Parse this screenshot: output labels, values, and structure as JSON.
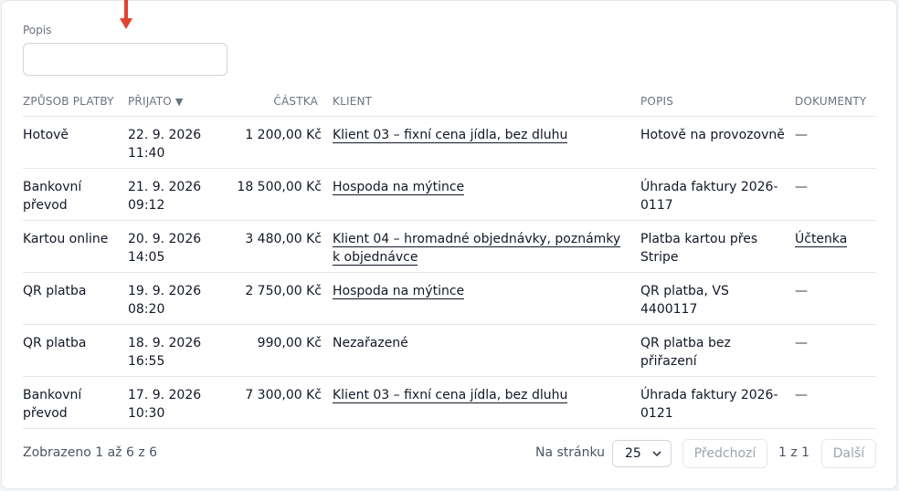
{
  "filter": {
    "label": "Popis",
    "value": "",
    "placeholder": ""
  },
  "columns": {
    "method": "ZPŮSOB PLATBY",
    "received": "PŘIJATO",
    "received_sort": "▼",
    "amount": "ČÁSTKA",
    "client": "KLIENT",
    "description": "POPIS",
    "documents": "DOKUMENTY"
  },
  "rows": [
    {
      "method": "Hotově",
      "date": "22. 9. 2026",
      "time": "11:40",
      "amount": "1 200,00 Kč",
      "client": "Klient 03 – fixní cena jídla, bez dluhu",
      "client_link": true,
      "description": "Hotově na provozovně",
      "document": "—",
      "document_link": false
    },
    {
      "method": "Bankovní převod",
      "date": "21. 9. 2026",
      "time": "09:12",
      "amount": "18 500,00 Kč",
      "client": "Hospoda na mýtince",
      "client_link": true,
      "description": "Úhrada faktury 2026-0117",
      "document": "—",
      "document_link": false
    },
    {
      "method": "Kartou online",
      "date": "20. 9. 2026",
      "time": "14:05",
      "amount": "3 480,00 Kč",
      "client": "Klient 04 – hromadné objednávky, poznámky k objednávce",
      "client_link": true,
      "description": "Platba kartou přes Stripe",
      "document": "Účtenka",
      "document_link": true
    },
    {
      "method": "QR platba",
      "date": "19. 9. 2026",
      "time": "08:20",
      "amount": "2 750,00 Kč",
      "client": "Hospoda na mýtince",
      "client_link": true,
      "description": "QR platba, VS 4400117",
      "document": "—",
      "document_link": false
    },
    {
      "method": "QR platba",
      "date": "18. 9. 2026",
      "time": "16:55",
      "amount": "990,00 Kč",
      "client": "Nezařazené",
      "client_link": false,
      "description": "QR platba bez přiřazení",
      "document": "—",
      "document_link": false
    },
    {
      "method": "Bankovní převod",
      "date": "17. 9. 2026",
      "time": "10:30",
      "amount": "7 300,00 Kč",
      "client": "Klient 03 – fixní cena jídla, bez dluhu",
      "client_link": true,
      "description": "Úhrada faktury 2026-0121",
      "document": "—",
      "document_link": false
    }
  ],
  "footer": {
    "summary": "Zobrazeno 1 až 6 z 6",
    "per_page_label": "Na stránku",
    "per_page_value": "25",
    "prev_label": "Předchozí",
    "page_info": "1 z 1",
    "next_label": "Další"
  },
  "colors": {
    "annotation_arrow": "#e0432f",
    "border": "#e5e7eb",
    "muted_text": "#6b7280"
  }
}
